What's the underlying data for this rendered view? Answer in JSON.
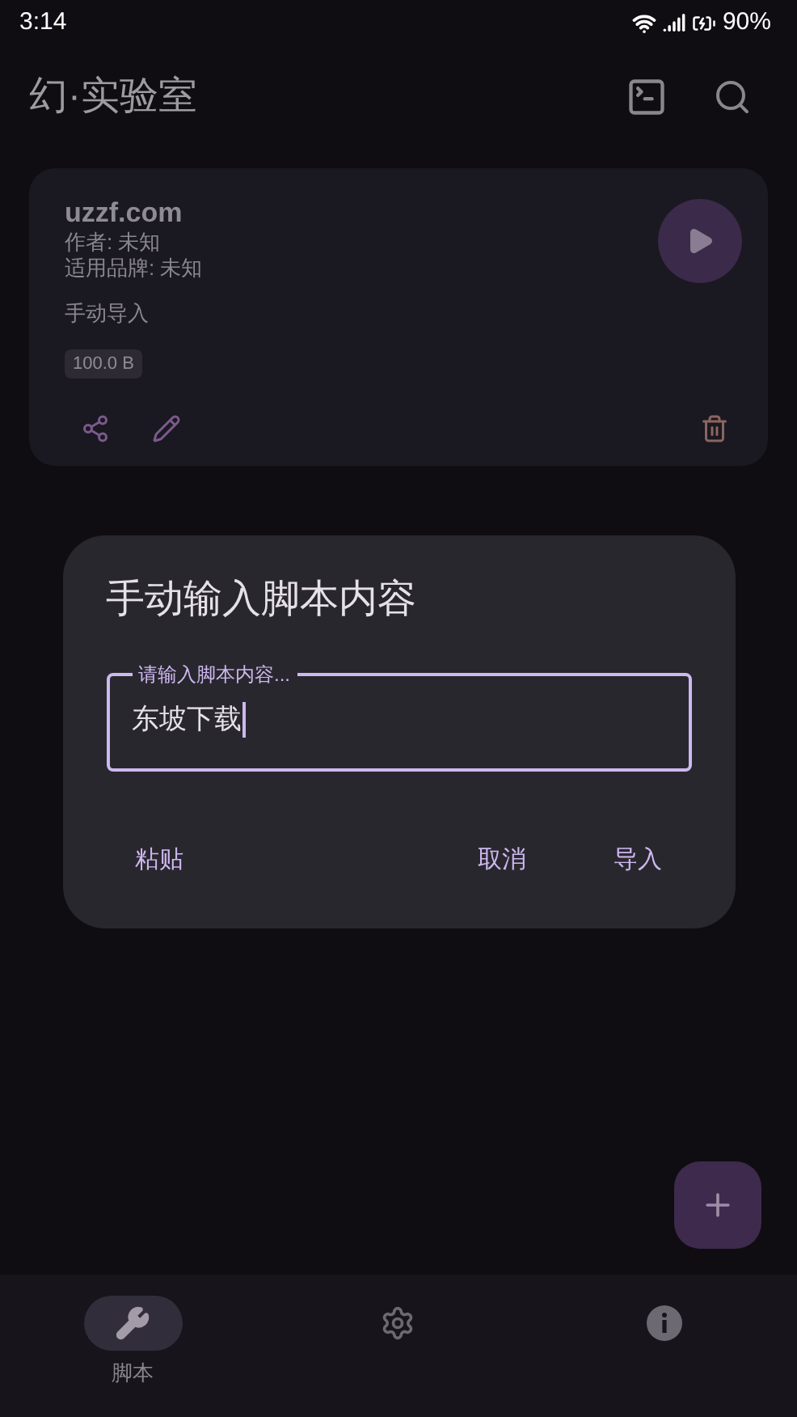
{
  "status_bar": {
    "time": "3:14",
    "battery": "90%"
  },
  "app_bar": {
    "title": "幻·实验室"
  },
  "scripts": [
    {
      "name": "uzzf.com",
      "author": "作者: 未知",
      "brand": "适用品牌: 未知",
      "source": "手动导入",
      "size": "100.0 B"
    }
  ],
  "dialog": {
    "title": "手动输入脚本内容",
    "field": {
      "label": "请输入脚本内容...",
      "value": "东坡下载",
      "focused": true
    },
    "buttons": [
      "粘贴",
      "取消",
      "导入"
    ]
  },
  "nav": [
    {
      "label": "脚本",
      "selected": true
    },
    {
      "selected": false
    },
    {
      "selected": false
    }
  ]
}
